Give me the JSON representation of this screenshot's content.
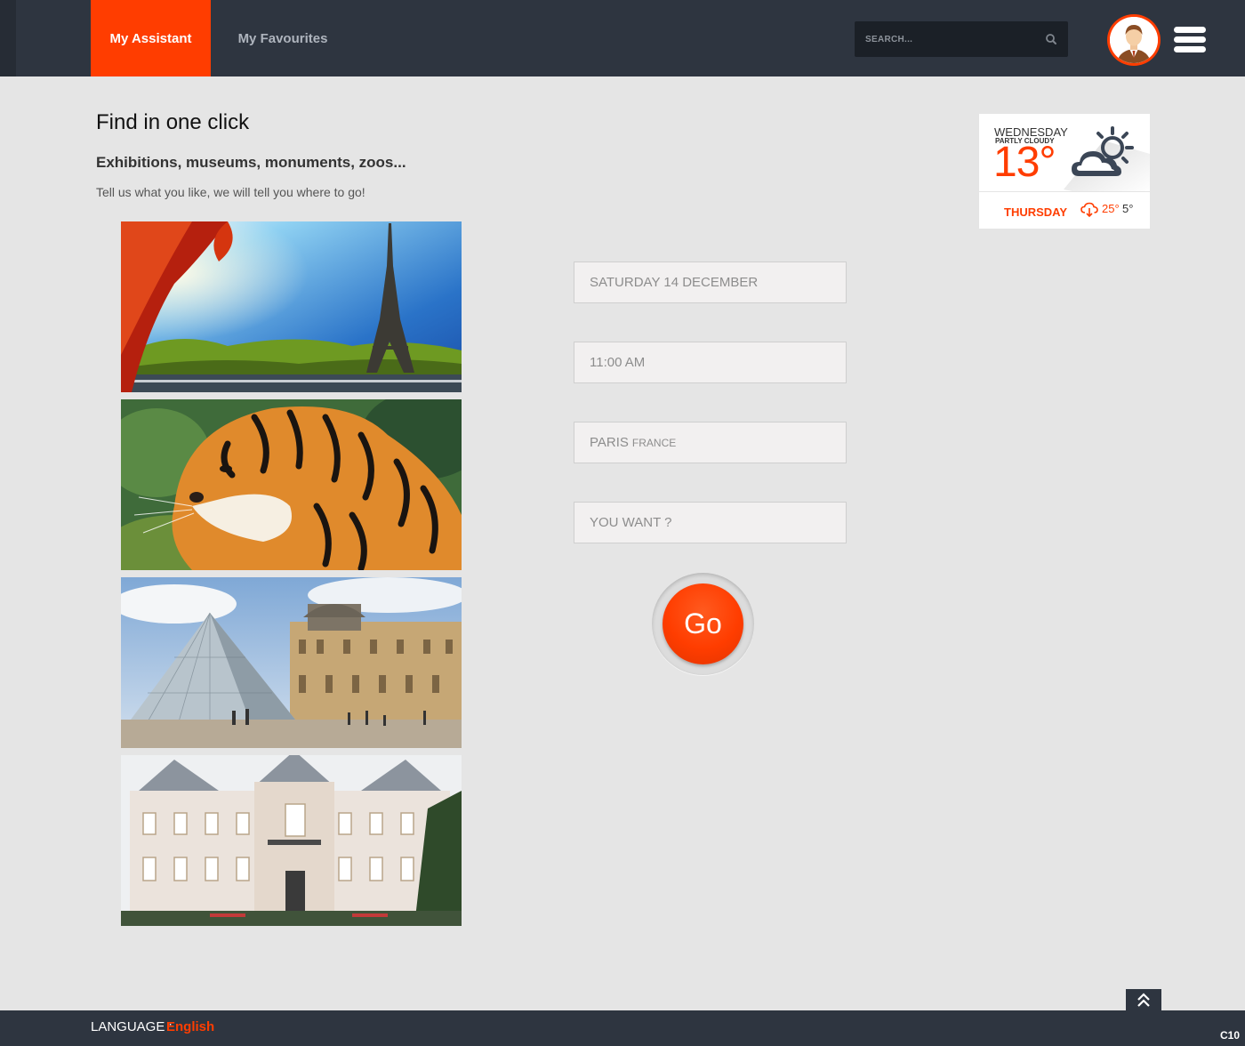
{
  "nav": {
    "tabs": [
      {
        "label": "My Assistant",
        "active": true
      },
      {
        "label": "My Favourites",
        "active": false
      }
    ],
    "search_placeholder": "SEARCH...",
    "search_icon": "search-icon",
    "avatar_icon": "user-avatar",
    "menu_icon": "hamburger-menu-icon"
  },
  "main": {
    "title": "Find in one click",
    "subtitle": "Exhibitions, museums, monuments, zoos...",
    "tagline": "Tell us what you like, we will tell you where to go!",
    "photos": [
      "eiffel-tower-photo",
      "tiger-photo",
      "louvre-pyramid-photo",
      "palace-museum-photo"
    ]
  },
  "form": {
    "date": "SATURDAY 14 DECEMBER",
    "time": "11:00 AM",
    "city": "PARIS",
    "country": "FRANCE",
    "want_placeholder": "YOU WANT ?",
    "go_label": "Go"
  },
  "weather": {
    "day": "WEDNESDAY",
    "condition": "PARTLY CLOUDY",
    "temperature": "13°",
    "next_day": "THURSDAY",
    "next_high": "25°",
    "next_low": "5°"
  },
  "footer": {
    "language_label": "LANGUAGE :",
    "language_value": "English",
    "version": "C10"
  },
  "colors": {
    "accent": "#ff3d00",
    "topbar": "#2e3540",
    "background": "#e5e5e5"
  }
}
